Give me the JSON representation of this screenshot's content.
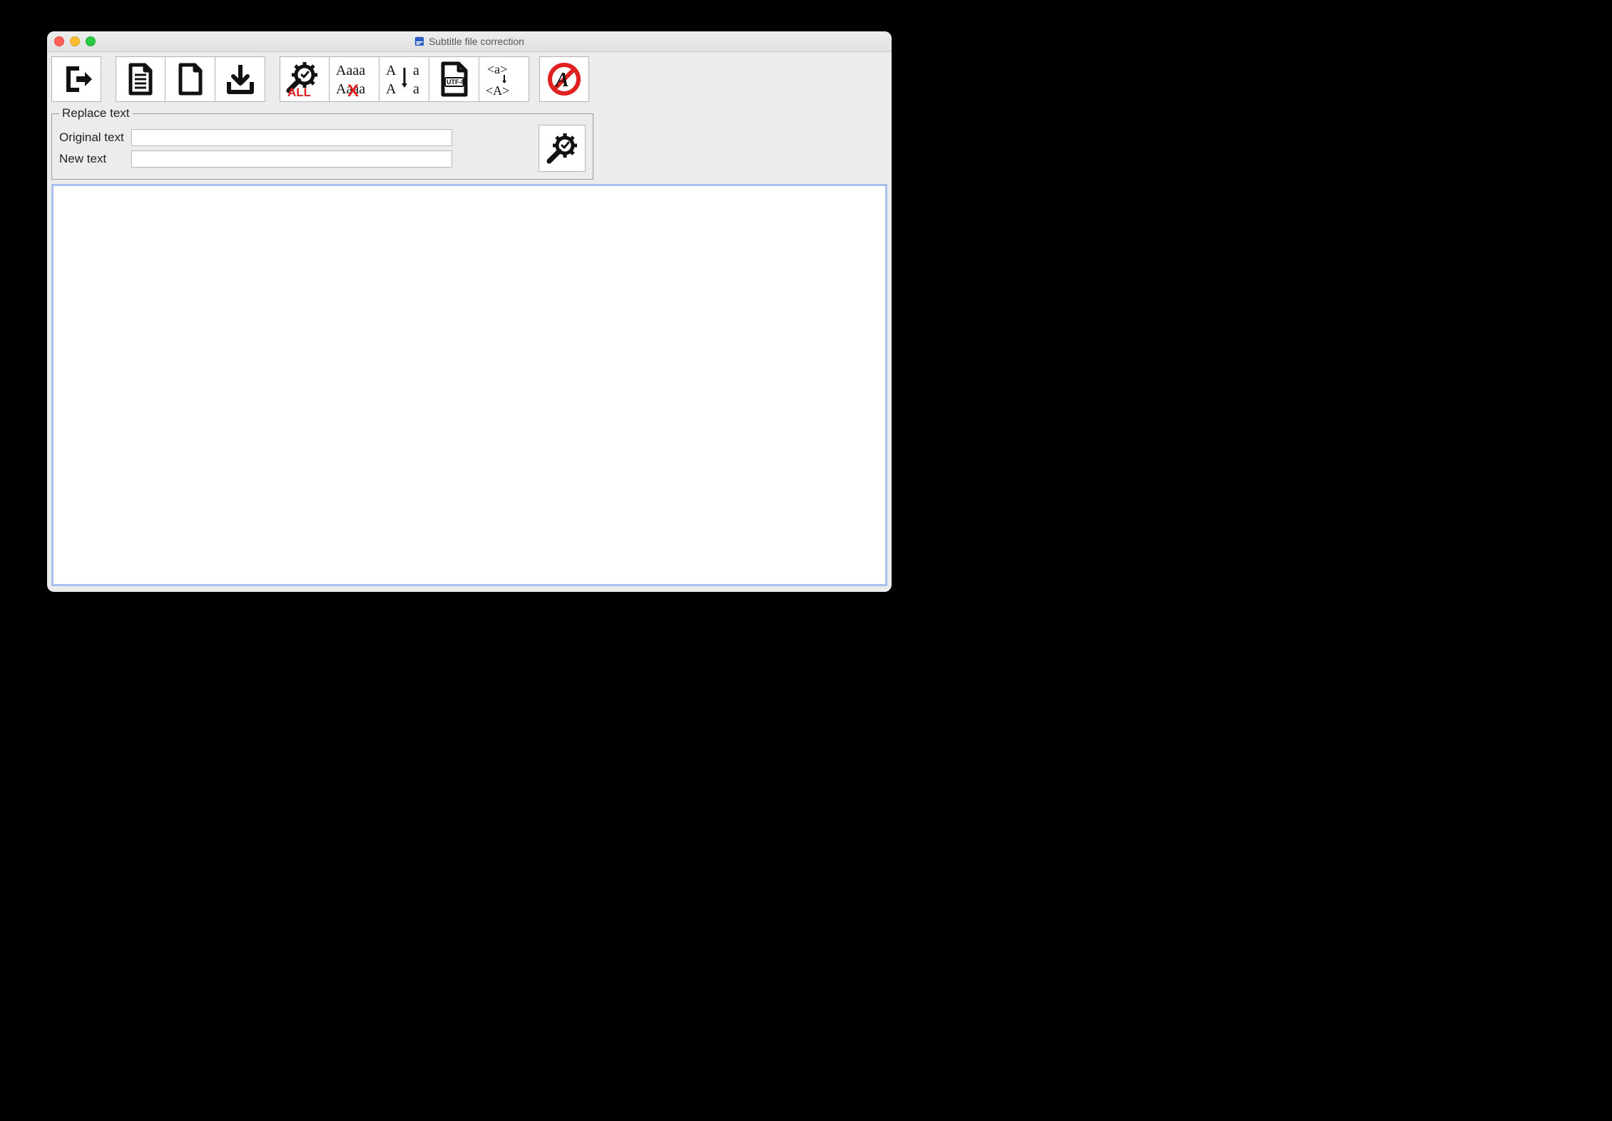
{
  "window": {
    "title": "Subtitle file correction"
  },
  "replace": {
    "legend": "Replace text",
    "original_label": "Original text",
    "new_label": "New text",
    "original_value": "",
    "new_value": ""
  },
  "editor": {
    "content": ""
  },
  "icons": {
    "exit": "exit-icon",
    "open_file": "open-file-icon",
    "new_file": "new-file-icon",
    "save_file": "save-file-icon",
    "fix_all": "fix-all-icon",
    "remove_case_dup": "remove-case-duplicates-icon",
    "change_case": "change-case-icon",
    "encoding_utf8": "encoding-utf8-icon",
    "convert_tags": "convert-tags-icon",
    "disable_style": "disable-style-icon",
    "run_replace": "run-replace-icon"
  }
}
